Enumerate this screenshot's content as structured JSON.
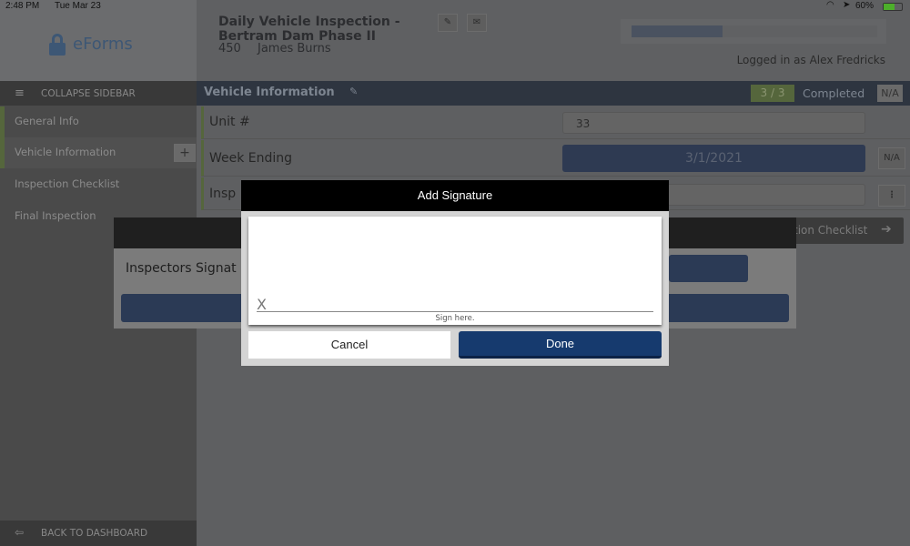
{
  "status": {
    "time": "2:48 PM",
    "date": "Tue Mar 23",
    "battery": "60%",
    "icons": [
      "wifi-icon",
      "location-icon",
      "battery-charging-icon"
    ]
  },
  "logo": {
    "text": "eForms"
  },
  "header": {
    "title_line1": "Daily Vehicle Inspection -",
    "title_line2": "Bertram Dam Phase II",
    "number": "450",
    "user": "James  Burns",
    "logged_in": "Logged in as Alex Fredricks",
    "progress_percent": 37
  },
  "sidebar": {
    "collapse_label": "COLLAPSE SIDEBAR",
    "items": [
      {
        "label": "General Info"
      },
      {
        "label": "Vehicle Information"
      },
      {
        "label": "Inspection Checklist"
      },
      {
        "label": "Final Inspection"
      }
    ],
    "back_label": "BACK TO DASHBOARD",
    "add_label": "+"
  },
  "section": {
    "title": "Vehicle Information",
    "count": "3 / 3",
    "status": "Completed",
    "na": "N/A"
  },
  "fields": [
    {
      "label": "Unit #",
      "value": "33"
    },
    {
      "label": "Week Ending",
      "value": "3/1/2021",
      "na": "N/A"
    },
    {
      "label": "Insp",
      "value": "",
      "menu": "⋮"
    }
  ],
  "next_button": {
    "label": "tion Checklist"
  },
  "bg_dialog": {
    "label": "Inspectors Signat"
  },
  "modal": {
    "title": "Add Signature",
    "x_mark": "X",
    "sign_hint": "Sign here.",
    "cancel": "Cancel",
    "done": "Done"
  },
  "colors": {
    "accent_blue": "#163a6e",
    "section_bar": "#2e3540",
    "green": "#55663c"
  }
}
